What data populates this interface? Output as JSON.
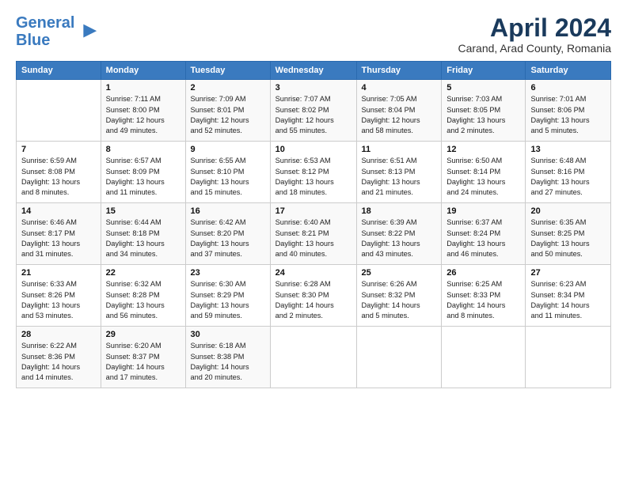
{
  "header": {
    "logo_line1": "General",
    "logo_line2": "Blue",
    "title": "April 2024",
    "subtitle": "Carand, Arad County, Romania"
  },
  "columns": [
    "Sunday",
    "Monday",
    "Tuesday",
    "Wednesday",
    "Thursday",
    "Friday",
    "Saturday"
  ],
  "weeks": [
    [
      {
        "day": "",
        "info": ""
      },
      {
        "day": "1",
        "info": "Sunrise: 7:11 AM\nSunset: 8:00 PM\nDaylight: 12 hours\nand 49 minutes."
      },
      {
        "day": "2",
        "info": "Sunrise: 7:09 AM\nSunset: 8:01 PM\nDaylight: 12 hours\nand 52 minutes."
      },
      {
        "day": "3",
        "info": "Sunrise: 7:07 AM\nSunset: 8:02 PM\nDaylight: 12 hours\nand 55 minutes."
      },
      {
        "day": "4",
        "info": "Sunrise: 7:05 AM\nSunset: 8:04 PM\nDaylight: 12 hours\nand 58 minutes."
      },
      {
        "day": "5",
        "info": "Sunrise: 7:03 AM\nSunset: 8:05 PM\nDaylight: 13 hours\nand 2 minutes."
      },
      {
        "day": "6",
        "info": "Sunrise: 7:01 AM\nSunset: 8:06 PM\nDaylight: 13 hours\nand 5 minutes."
      }
    ],
    [
      {
        "day": "7",
        "info": "Sunrise: 6:59 AM\nSunset: 8:08 PM\nDaylight: 13 hours\nand 8 minutes."
      },
      {
        "day": "8",
        "info": "Sunrise: 6:57 AM\nSunset: 8:09 PM\nDaylight: 13 hours\nand 11 minutes."
      },
      {
        "day": "9",
        "info": "Sunrise: 6:55 AM\nSunset: 8:10 PM\nDaylight: 13 hours\nand 15 minutes."
      },
      {
        "day": "10",
        "info": "Sunrise: 6:53 AM\nSunset: 8:12 PM\nDaylight: 13 hours\nand 18 minutes."
      },
      {
        "day": "11",
        "info": "Sunrise: 6:51 AM\nSunset: 8:13 PM\nDaylight: 13 hours\nand 21 minutes."
      },
      {
        "day": "12",
        "info": "Sunrise: 6:50 AM\nSunset: 8:14 PM\nDaylight: 13 hours\nand 24 minutes."
      },
      {
        "day": "13",
        "info": "Sunrise: 6:48 AM\nSunset: 8:16 PM\nDaylight: 13 hours\nand 27 minutes."
      }
    ],
    [
      {
        "day": "14",
        "info": "Sunrise: 6:46 AM\nSunset: 8:17 PM\nDaylight: 13 hours\nand 31 minutes."
      },
      {
        "day": "15",
        "info": "Sunrise: 6:44 AM\nSunset: 8:18 PM\nDaylight: 13 hours\nand 34 minutes."
      },
      {
        "day": "16",
        "info": "Sunrise: 6:42 AM\nSunset: 8:20 PM\nDaylight: 13 hours\nand 37 minutes."
      },
      {
        "day": "17",
        "info": "Sunrise: 6:40 AM\nSunset: 8:21 PM\nDaylight: 13 hours\nand 40 minutes."
      },
      {
        "day": "18",
        "info": "Sunrise: 6:39 AM\nSunset: 8:22 PM\nDaylight: 13 hours\nand 43 minutes."
      },
      {
        "day": "19",
        "info": "Sunrise: 6:37 AM\nSunset: 8:24 PM\nDaylight: 13 hours\nand 46 minutes."
      },
      {
        "day": "20",
        "info": "Sunrise: 6:35 AM\nSunset: 8:25 PM\nDaylight: 13 hours\nand 50 minutes."
      }
    ],
    [
      {
        "day": "21",
        "info": "Sunrise: 6:33 AM\nSunset: 8:26 PM\nDaylight: 13 hours\nand 53 minutes."
      },
      {
        "day": "22",
        "info": "Sunrise: 6:32 AM\nSunset: 8:28 PM\nDaylight: 13 hours\nand 56 minutes."
      },
      {
        "day": "23",
        "info": "Sunrise: 6:30 AM\nSunset: 8:29 PM\nDaylight: 13 hours\nand 59 minutes."
      },
      {
        "day": "24",
        "info": "Sunrise: 6:28 AM\nSunset: 8:30 PM\nDaylight: 14 hours\nand 2 minutes."
      },
      {
        "day": "25",
        "info": "Sunrise: 6:26 AM\nSunset: 8:32 PM\nDaylight: 14 hours\nand 5 minutes."
      },
      {
        "day": "26",
        "info": "Sunrise: 6:25 AM\nSunset: 8:33 PM\nDaylight: 14 hours\nand 8 minutes."
      },
      {
        "day": "27",
        "info": "Sunrise: 6:23 AM\nSunset: 8:34 PM\nDaylight: 14 hours\nand 11 minutes."
      }
    ],
    [
      {
        "day": "28",
        "info": "Sunrise: 6:22 AM\nSunset: 8:36 PM\nDaylight: 14 hours\nand 14 minutes."
      },
      {
        "day": "29",
        "info": "Sunrise: 6:20 AM\nSunset: 8:37 PM\nDaylight: 14 hours\nand 17 minutes."
      },
      {
        "day": "30",
        "info": "Sunrise: 6:18 AM\nSunset: 8:38 PM\nDaylight: 14 hours\nand 20 minutes."
      },
      {
        "day": "",
        "info": ""
      },
      {
        "day": "",
        "info": ""
      },
      {
        "day": "",
        "info": ""
      },
      {
        "day": "",
        "info": ""
      }
    ]
  ]
}
